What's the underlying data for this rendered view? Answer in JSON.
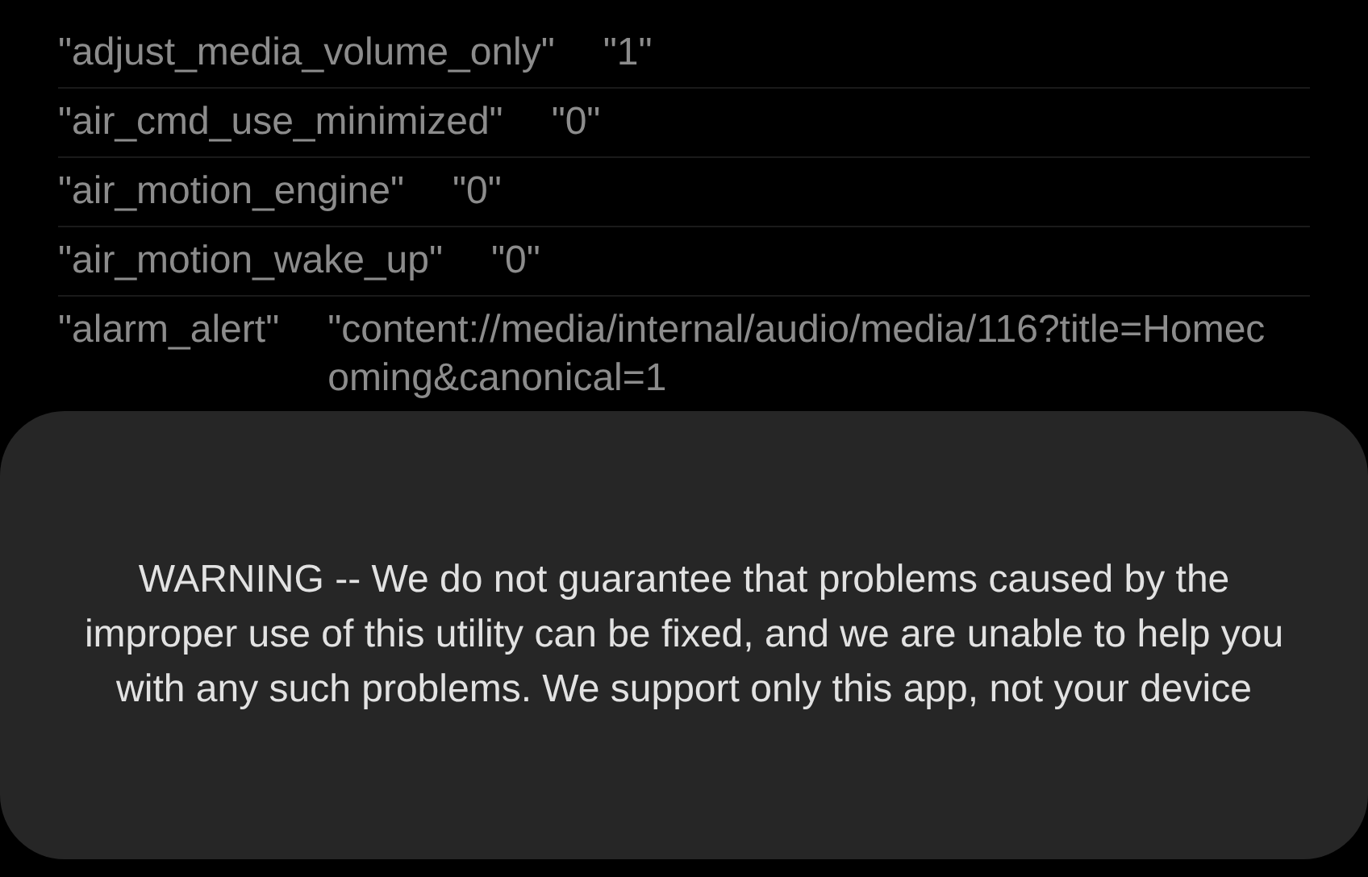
{
  "settings": [
    {
      "key": "\"adjust_media_volume_only\"",
      "value": "\"1\""
    },
    {
      "key": "\"air_cmd_use_minimized\"",
      "value": "\"0\""
    },
    {
      "key": "\"air_motion_engine\"",
      "value": "\"0\""
    },
    {
      "key": "\"air_motion_wake_up\"",
      "value": "\"0\""
    },
    {
      "key": "\"alarm_alert\"",
      "value": "\"content://media/internal/audio/media/116?title=Homecoming&canonical=1"
    }
  ],
  "toast": {
    "message": "WARNING -- We do not guarantee that problems caused by the improper use of this utility can be fixed, and we are unable to help you with any such problems. We support only this app, not your device"
  }
}
